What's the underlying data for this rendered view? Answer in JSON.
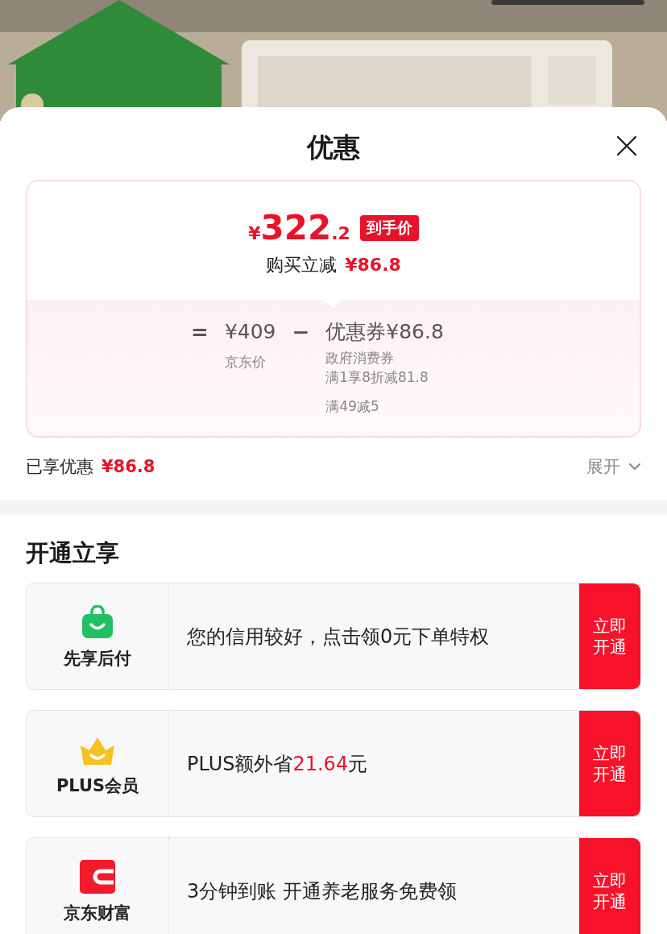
{
  "sheet": {
    "title": "优惠",
    "price_card": {
      "price_symbol": "¥",
      "price_integer": "322",
      "price_decimal": ".2",
      "price_tag": "到手价",
      "saving_label": "购买立减",
      "saving_amount": "¥86.8",
      "equals": "=",
      "base_price": "¥409",
      "base_label": "京东价",
      "minus": "−",
      "coupon_label": "优惠券",
      "coupon_amount": "¥86.8",
      "coupon_details": [
        {
          "lines": [
            "政府消费券",
            "满1享8折减81.8"
          ]
        },
        {
          "lines": [
            "满49减5"
          ]
        }
      ]
    },
    "enjoyed_label": "已享优惠",
    "enjoyed_amount": "¥86.8",
    "expand_label": "展开",
    "expanded": false,
    "section_title": "开通立享",
    "offers": [
      {
        "kind": "bag",
        "name": "先享后付",
        "segments": [
          {
            "text": "您的信用较好，点击领0元下单特权",
            "highlight": false
          }
        ],
        "button": "立即开通"
      },
      {
        "kind": "crown",
        "name": "PLUS会员",
        "segments": [
          {
            "text": "PLUS额外省 ",
            "highlight": false
          },
          {
            "text": "21.64",
            "highlight": true
          },
          {
            "text": "元",
            "highlight": false
          }
        ],
        "button": "立即开通"
      },
      {
        "kind": "wallet",
        "name": "京东财富",
        "segments": [
          {
            "text": "3分钟到账 开通养老服务免费领",
            "highlight": false
          }
        ],
        "button": "立即开通"
      }
    ]
  }
}
